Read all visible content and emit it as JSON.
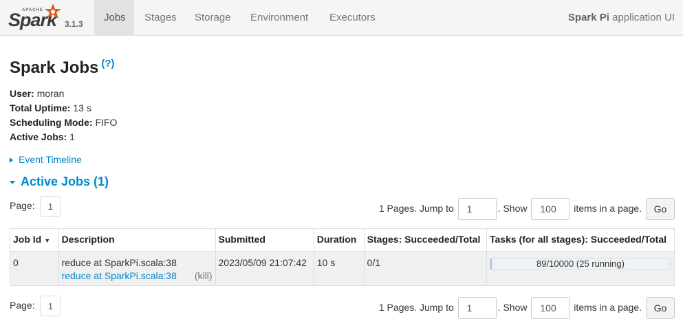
{
  "brand": {
    "apache": "APACHE",
    "spark": "Spark",
    "version": "3.1.3"
  },
  "nav": {
    "tabs": [
      {
        "label": "Jobs",
        "active": true
      },
      {
        "label": "Stages"
      },
      {
        "label": "Storage"
      },
      {
        "label": "Environment"
      },
      {
        "label": "Executors"
      }
    ],
    "app_name": "Spark Pi",
    "app_suffix": "application UI"
  },
  "page": {
    "title": "Spark Jobs",
    "help": "(?)"
  },
  "summary": {
    "user_label": "User:",
    "user": "moran",
    "uptime_label": "Total Uptime:",
    "uptime": "13 s",
    "mode_label": "Scheduling Mode:",
    "mode": "FIFO",
    "active_label": "Active Jobs:",
    "active": "1"
  },
  "event_timeline": "Event Timeline",
  "active_jobs_header": "Active Jobs (1)",
  "paging": {
    "page_label": "Page:",
    "current_page": "1",
    "pages_text": "1 Pages. Jump to",
    "jump_value": "1",
    "show_text": ". Show",
    "show_value": "100",
    "items_text": "items in a page.",
    "go_label": "Go"
  },
  "table": {
    "headers": {
      "job_id": "Job Id",
      "sort_arrow": "▼",
      "description": "Description",
      "submitted": "Submitted",
      "duration": "Duration",
      "stages": "Stages: Succeeded/Total",
      "tasks": "Tasks (for all stages): Succeeded/Total"
    },
    "rows": [
      {
        "job_id": "0",
        "description": "reduce at SparkPi.scala:38",
        "description_link": "reduce at SparkPi.scala:38",
        "kill": "(kill)",
        "submitted": "2023/05/09 21:07:42",
        "duration": "10 s",
        "stages": "0/1",
        "tasks_text": "89/10000 (25 running)",
        "tasks_progress": 0.0089
      }
    ]
  }
}
